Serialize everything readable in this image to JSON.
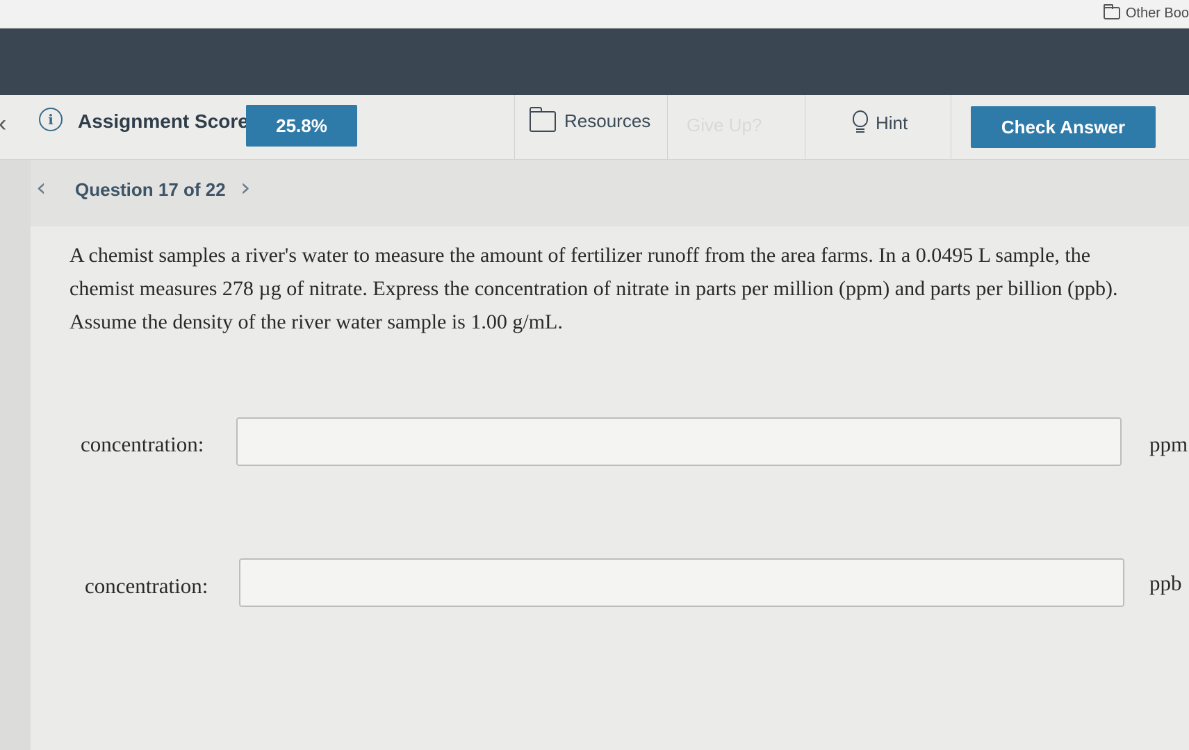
{
  "browser": {
    "bookmark_folder_label": "Other Boo"
  },
  "toolbar": {
    "score_label": "Assignment Score:",
    "score_value": "25.8%",
    "resources_label": "Resources",
    "give_up_label": "Give Up?",
    "hint_label": "Hint",
    "check_answer_label": "Check Answer"
  },
  "nav": {
    "question_title": "Question 17 of 22",
    "prev_glyph": "‹",
    "next_glyph": "›"
  },
  "question": {
    "text": "A chemist samples a river's water to measure the amount of fertilizer runoff from the area farms. In a 0.0495 L sample, the chemist measures 278 µg of nitrate. Express the concentration of nitrate in parts per million (ppm) and parts per billion (ppb). Assume the density of the river water sample is 1.00 g/mL."
  },
  "answers": [
    {
      "label": "concentration:",
      "value": "",
      "unit": "ppm"
    },
    {
      "label": "concentration:",
      "value": "",
      "unit": "ppb"
    }
  ],
  "colors": {
    "accent": "#2e7aa8",
    "header": "#3a4651"
  }
}
